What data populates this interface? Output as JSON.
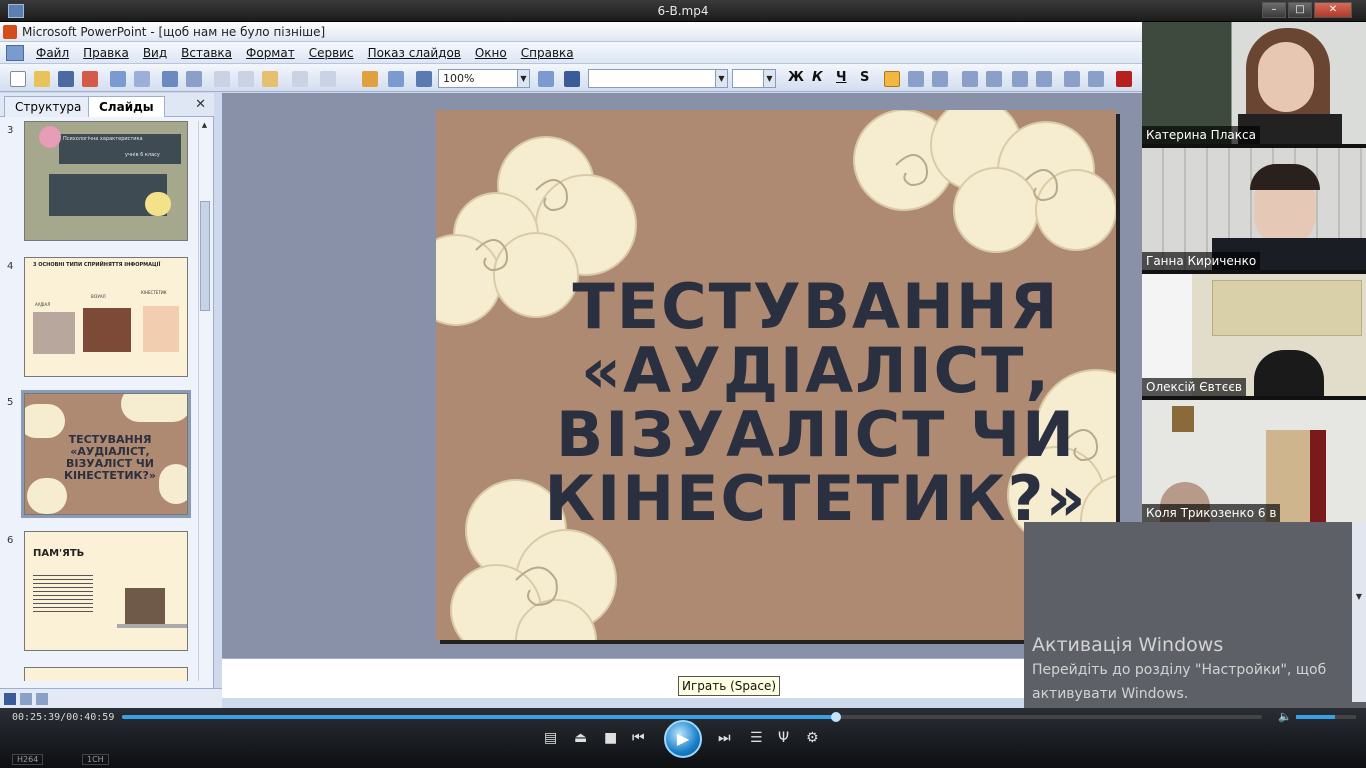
{
  "player": {
    "window_title": "6-В.mp4",
    "time_display": "00:25:39/00:40:59",
    "progress_fraction": 0.626,
    "volume_fraction": 0.65,
    "tooltip": "Играть (Space)",
    "badges": [
      "H264",
      "1CH"
    ]
  },
  "ppt": {
    "window_title": "Microsoft PowerPoint - [щоб нам не було пізніше]",
    "menu": [
      "Файл",
      "Правка",
      "Вид",
      "Вставка",
      "Формат",
      "Сервис",
      "Показ слайдов",
      "Окно",
      "Справка"
    ],
    "zoom": "100%",
    "tabs": {
      "outline": "Структура",
      "slides": "Слайды"
    },
    "format_buttons": [
      "Ж",
      "К",
      "Ч",
      "S"
    ],
    "slide_numbers": [
      "3",
      "4",
      "5",
      "6"
    ],
    "thumb3": {
      "line1": "Психологічна характеристика",
      "line2": "учнів 6 класу"
    },
    "thumb4": {
      "title": "3 ОСНОВНІ ТИПИ СПРИЙНЯТТЯ ІНФОРМАЦІЇ",
      "labels": [
        "АУДІАЛ",
        "ВІЗУАЛ",
        "КІНЕСТЕТИК"
      ]
    },
    "thumb5": {
      "title": "ТЕСТУВАННЯ «АУДІАЛІСТ, ВІЗУАЛІСТ ЧИ КІНЕСТЕТИК?»"
    },
    "thumb6": {
      "title": "ПАМ'ЯТЬ"
    },
    "current_slide": {
      "title_lines": [
        "ТЕСТУВАННЯ",
        "«АУДІАЛІСТ,",
        "ВІЗУАЛІСТ ЧИ",
        "КІНЕСТЕТИК?»"
      ]
    }
  },
  "participants": [
    {
      "name": "Катерина Плакса"
    },
    {
      "name": "Ганна Кириченко"
    },
    {
      "name": "Олексій Євтєєв"
    },
    {
      "name": "Коля Трикозенко 6 в"
    }
  ],
  "activation": {
    "heading": "Активація Windows",
    "line1": "Перейдіть до розділу \"Настройки\", щоб",
    "line2": "активувати Windows."
  },
  "colors": {
    "slide_bg": "#af8a73",
    "cloud": "#f6ecd0",
    "title_text": "#2b3040",
    "accent": "#3aa0e6"
  }
}
